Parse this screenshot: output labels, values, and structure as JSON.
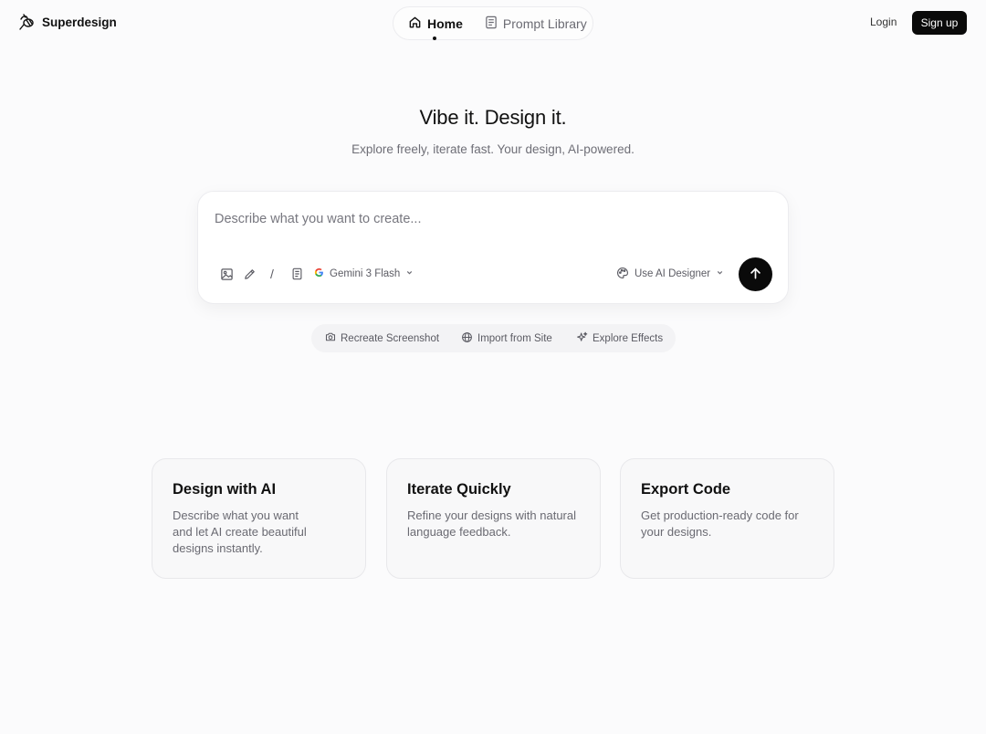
{
  "brand": {
    "name": "Superdesign",
    "logo_icon": "bee-logo-icon"
  },
  "nav": {
    "items": [
      {
        "label": "Home",
        "icon": "home-icon",
        "active": true
      },
      {
        "label": "Prompt Library",
        "icon": "document-icon",
        "active": false
      }
    ]
  },
  "auth": {
    "login_label": "Login",
    "signup_label": "Sign up"
  },
  "hero": {
    "title": "Vibe it. Design it.",
    "subtitle": "Explore freely, iterate fast. Your design, AI-powered."
  },
  "prompt": {
    "placeholder": "Describe what you want to create...",
    "value": "",
    "tools": [
      "image-icon",
      "pencil-icon",
      "slash-command-icon",
      "document-icon"
    ],
    "slash_label": "/",
    "model": {
      "label": "Gemini 3 Flash",
      "icon": "google-icon"
    },
    "designer": {
      "label": "Use AI Designer",
      "icon": "palette-icon"
    },
    "send_icon": "arrow-up-icon"
  },
  "quick_actions": [
    {
      "label": "Recreate Screenshot",
      "icon": "camera-icon"
    },
    {
      "label": "Import from Site",
      "icon": "globe-icon"
    },
    {
      "label": "Explore Effects",
      "icon": "sparkle-icon"
    }
  ],
  "features": [
    {
      "title": "Design with AI",
      "description": "Describe what you want and let AI create beautiful designs instantly."
    },
    {
      "title": "Iterate Quickly",
      "description": "Refine your designs with natural language feedback."
    },
    {
      "title": "Export Code",
      "description": "Get production-ready code for your designs."
    }
  ],
  "colors": {
    "primary": "#0a0a0a",
    "background": "#fbfbfc",
    "muted_text": "#6e6e76"
  }
}
